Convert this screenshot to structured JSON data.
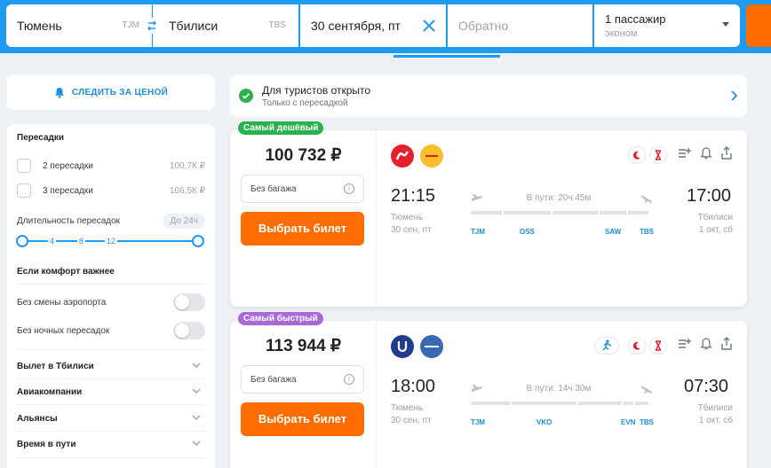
{
  "search": {
    "from_city": "Тюмень",
    "from_code": "TJM",
    "to_city": "Тбилиси",
    "to_code": "TBS",
    "date": "30 сентября, пт",
    "return_placeholder": "Обратно",
    "passengers": "1 пассажир",
    "cabin": "эконом"
  },
  "sidebar": {
    "track_price": "СЛЕДИТЬ ЗА ЦЕНОЙ",
    "transfers_title": "Пересадки",
    "transfer_options": [
      {
        "label": "2 пересадки",
        "price": "100,7К ₽"
      },
      {
        "label": "3 пересадки",
        "price": "106,5К ₽"
      }
    ],
    "layover_title": "Длительность пересадок",
    "layover_range": "До 24ч",
    "slider_ticks": [
      "4",
      "8",
      "12"
    ],
    "comfort_title": "Если комфорт важнее",
    "toggles": [
      {
        "label": "Без смены аэропорта"
      },
      {
        "label": "Без ночных пересадок"
      }
    ],
    "accordions": [
      {
        "label": "Вылет в Тбилиси"
      },
      {
        "label": "Авиакомпании"
      },
      {
        "label": "Альянсы"
      },
      {
        "label": "Время в пути"
      }
    ]
  },
  "notice": {
    "title": "Для туристов открыто",
    "subtitle": "Только с пересадкой"
  },
  "tickets": [
    {
      "badge": "Самый дешёвый",
      "price": "100 732 ₽",
      "baggage": "Без багажа",
      "buy": "Выбрать билет",
      "airline_logos": [
        "nordwind-logo",
        "pegasus-logo"
      ],
      "dep_time": "21:15",
      "dep_city": "Тюмень",
      "dep_date": "30 сен, пт",
      "arr_time": "17:00",
      "arr_city": "Тбилиси",
      "arr_date": "1 окт, сб",
      "duration": "В пути: 20ч 45м",
      "stops": [
        "TJM",
        "OSS",
        "SAW",
        "TBS"
      ]
    },
    {
      "badge": "Самый быстрый",
      "price": "113 944 ₽",
      "baggage": "Без багажа",
      "buy": "Выбрать билет",
      "airline_logos": [
        "utair-logo",
        "armenia-logo"
      ],
      "dep_time": "18:00",
      "dep_city": "Тюмень",
      "dep_date": "30 сен, пт",
      "arr_time": "07:30",
      "arr_city": "Тбилиси",
      "arr_date": "1 окт, сб",
      "duration": "В пути: 14ч 30м",
      "stops": [
        "TJM",
        "VKO",
        "EVN",
        "TBS"
      ]
    }
  ],
  "colors": {
    "brand_blue": "#1e9af0",
    "accent_orange": "#ff6d00",
    "cheapest_green": "#28b14c",
    "fastest_purple": "#a968d8"
  }
}
